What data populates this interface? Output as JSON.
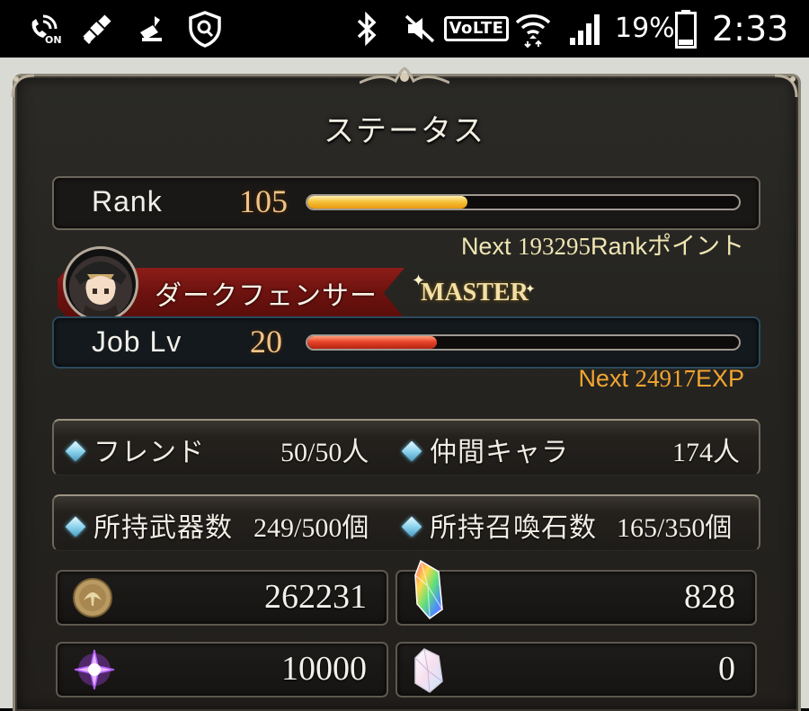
{
  "status_bar": {
    "battery_percent": "19%",
    "time": "2:33",
    "icons": [
      "hd-call-icon",
      "satellite-icon",
      "cleaner-icon",
      "shield-search-icon",
      "bluetooth-icon",
      "mute-icon",
      "volte-icon",
      "wifi-icon",
      "signal-icon",
      "battery-icon"
    ],
    "volte_label": "VoLTE",
    "call_on_label": "ON"
  },
  "panel": {
    "title": "ステータス"
  },
  "rank": {
    "label": "Rank",
    "value": "105",
    "progress": 0.37,
    "next_prefix": "Next ",
    "next_value": "193295",
    "next_suffix": "Rankポイント"
  },
  "job": {
    "name": "ダークフェンサー",
    "badge": "MASTER",
    "label": "Job Lv",
    "value": "20",
    "progress": 0.3,
    "next_prefix": "Next ",
    "next_value": "24917",
    "next_suffix": "EXP"
  },
  "stats": {
    "friend_label": "フレンド",
    "friend_value": "50/50",
    "friend_unit": "人",
    "crew_label": "仲間キャラ",
    "crew_value": "174",
    "crew_unit": "人",
    "weapons_label": "所持武器数",
    "weapons_value": "249/500",
    "weapons_unit": "個",
    "summons_label": "所持召喚石数",
    "summons_value": "165/350",
    "summons_unit": "個"
  },
  "currencies": {
    "rupie": {
      "icon": "rupie-coin-icon",
      "value": "262231"
    },
    "crystal": {
      "icon": "crystal-icon",
      "value": "828"
    },
    "renown": {
      "icon": "renown-star-icon",
      "value": "10000"
    },
    "ticket": {
      "icon": "gem-shard-icon",
      "value": "0"
    }
  },
  "colors": {
    "rank_bar": "#f6c23a",
    "job_bar": "#e8442a",
    "next_rank_text": "#efe6b3",
    "next_job_text": "#f2a531",
    "panel_bg": "#252420",
    "ribbon": "#6d120f"
  }
}
